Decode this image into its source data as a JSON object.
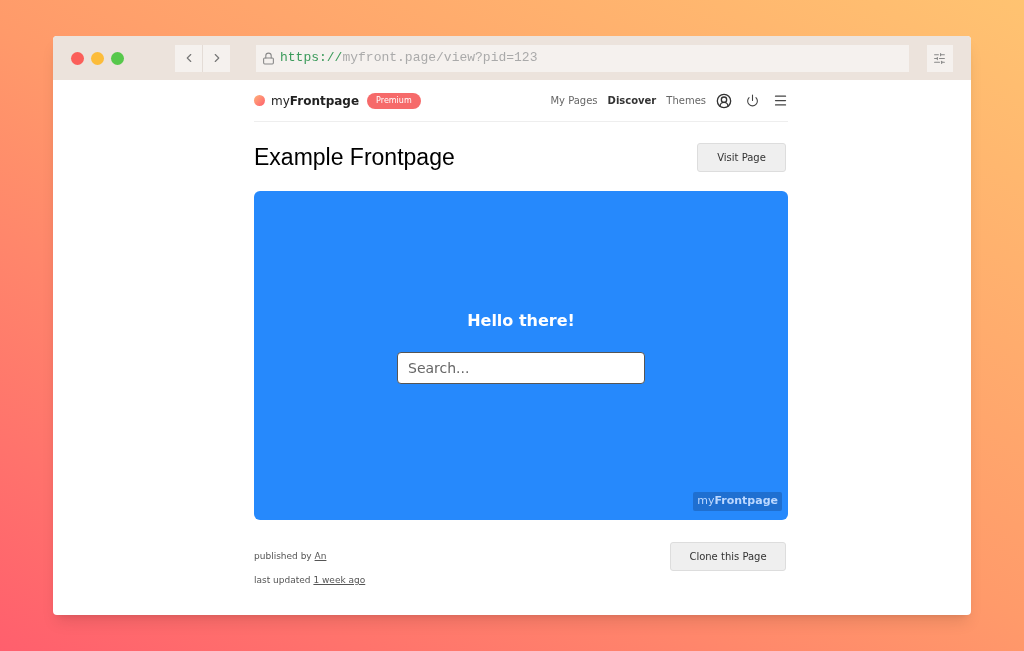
{
  "browser": {
    "url_scheme": "https://",
    "url_rest": "myfront.page/view?pid=123"
  },
  "header": {
    "logo": "my**Frontpage**",
    "badge": "Premium",
    "nav": [
      {
        "label": "My Pages",
        "selected": false
      },
      {
        "label": "Discover",
        "selected": true
      },
      {
        "label": "Themes",
        "selected": false
      }
    ]
  },
  "page": {
    "title": "Example Frontpage",
    "visit_button": "Visit Page"
  },
  "preview": {
    "heading": "Hello there!",
    "search": {
      "placeholder": "Search..."
    },
    "watermark": "my**Frontpage**"
  },
  "footer": {
    "published_label": "published by",
    "author": "An",
    "updated_label": "last updated",
    "updated": "1 week ago",
    "clone_button": "Clone this Page"
  }
}
